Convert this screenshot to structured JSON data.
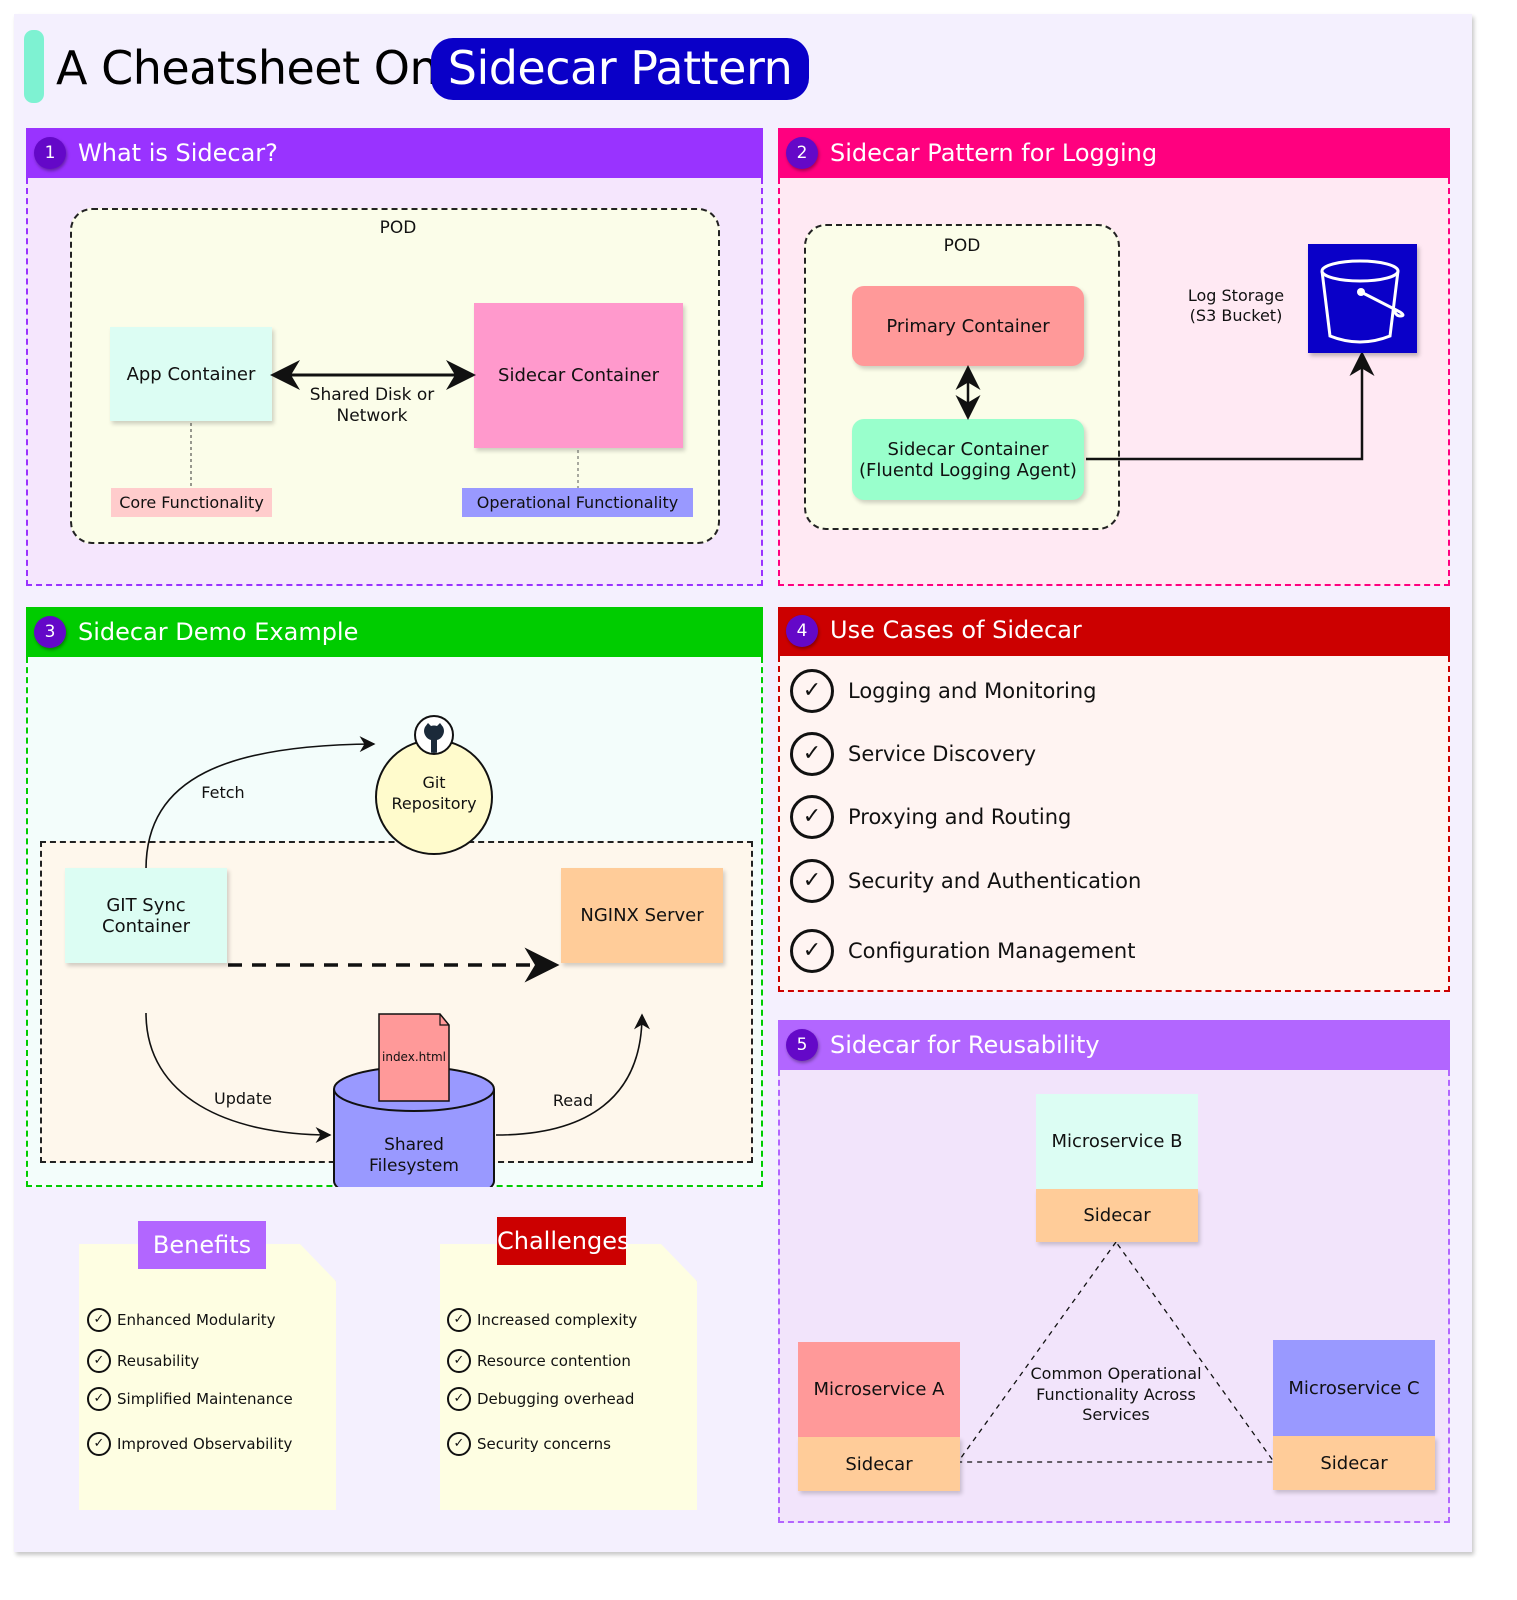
{
  "title": {
    "prefix": "A Cheatsheet On",
    "highlight": "Sidecar Pattern"
  },
  "colors": {
    "accent_bar": "#7ef2d2",
    "title_pill": "#0a00c8",
    "section1": "#9933ff",
    "section2": "#ff007f",
    "section3": "#00cc00",
    "section4": "#cc0000",
    "section5": "#b266ff",
    "badge": "#6408c8"
  },
  "sections": {
    "what_is": {
      "number": "1",
      "title": "What is Sidecar?",
      "pod_label": "POD",
      "app_container": "App Container",
      "sidecar_container": "Sidecar Container",
      "link_label_line1": "Shared Disk or",
      "link_label_line2": "Network",
      "core_functionality": "Core Functionality",
      "operational_functionality": "Operational Functionality"
    },
    "logging": {
      "number": "2",
      "title": "Sidecar Pattern for Logging",
      "pod_label": "POD",
      "primary_container": "Primary Container",
      "sidecar_line1": "Sidecar Container",
      "sidecar_line2": "(Fluentd Logging Agent)",
      "storage_line1": "Log Storage",
      "storage_line2": "(S3 Bucket)",
      "storage_icon": "s3-bucket-icon"
    },
    "demo": {
      "number": "3",
      "title": "Sidecar Demo Example",
      "git_repo_line1": "Git",
      "git_repo_line2": "Repository",
      "git_icon": "github-icon",
      "fetch_label": "Fetch",
      "git_sync_line1": "GIT Sync",
      "git_sync_line2": "Container",
      "nginx": "NGINX Server",
      "file": "index.html",
      "fs_line1": "Shared",
      "fs_line2": "Filesystem",
      "update_label": "Update",
      "read_label": "Read"
    },
    "use_cases": {
      "number": "4",
      "title": "Use Cases of Sidecar",
      "items": [
        "Logging and Monitoring",
        "Service Discovery",
        "Proxying and Routing",
        "Security and Authentication",
        "Configuration Management"
      ]
    },
    "reusability": {
      "number": "5",
      "title": "Sidecar for Reusability",
      "service_a": "Microservice A",
      "service_b": "Microservice B",
      "service_c": "Microservice C",
      "sidecar_label": "Sidecar",
      "center_line1": "Common Operational",
      "center_line2": "Functionality Across",
      "center_line3": "Services"
    }
  },
  "benefits": {
    "title": "Benefits",
    "items": [
      "Enhanced Modularity",
      "Reusability",
      "Simplified Maintenance",
      "Improved Observability"
    ]
  },
  "challenges": {
    "title": "Challenges",
    "items": [
      "Increased complexity",
      "Resource contention",
      "Debugging overhead",
      "Security concerns"
    ]
  },
  "check_glyph": "✓"
}
